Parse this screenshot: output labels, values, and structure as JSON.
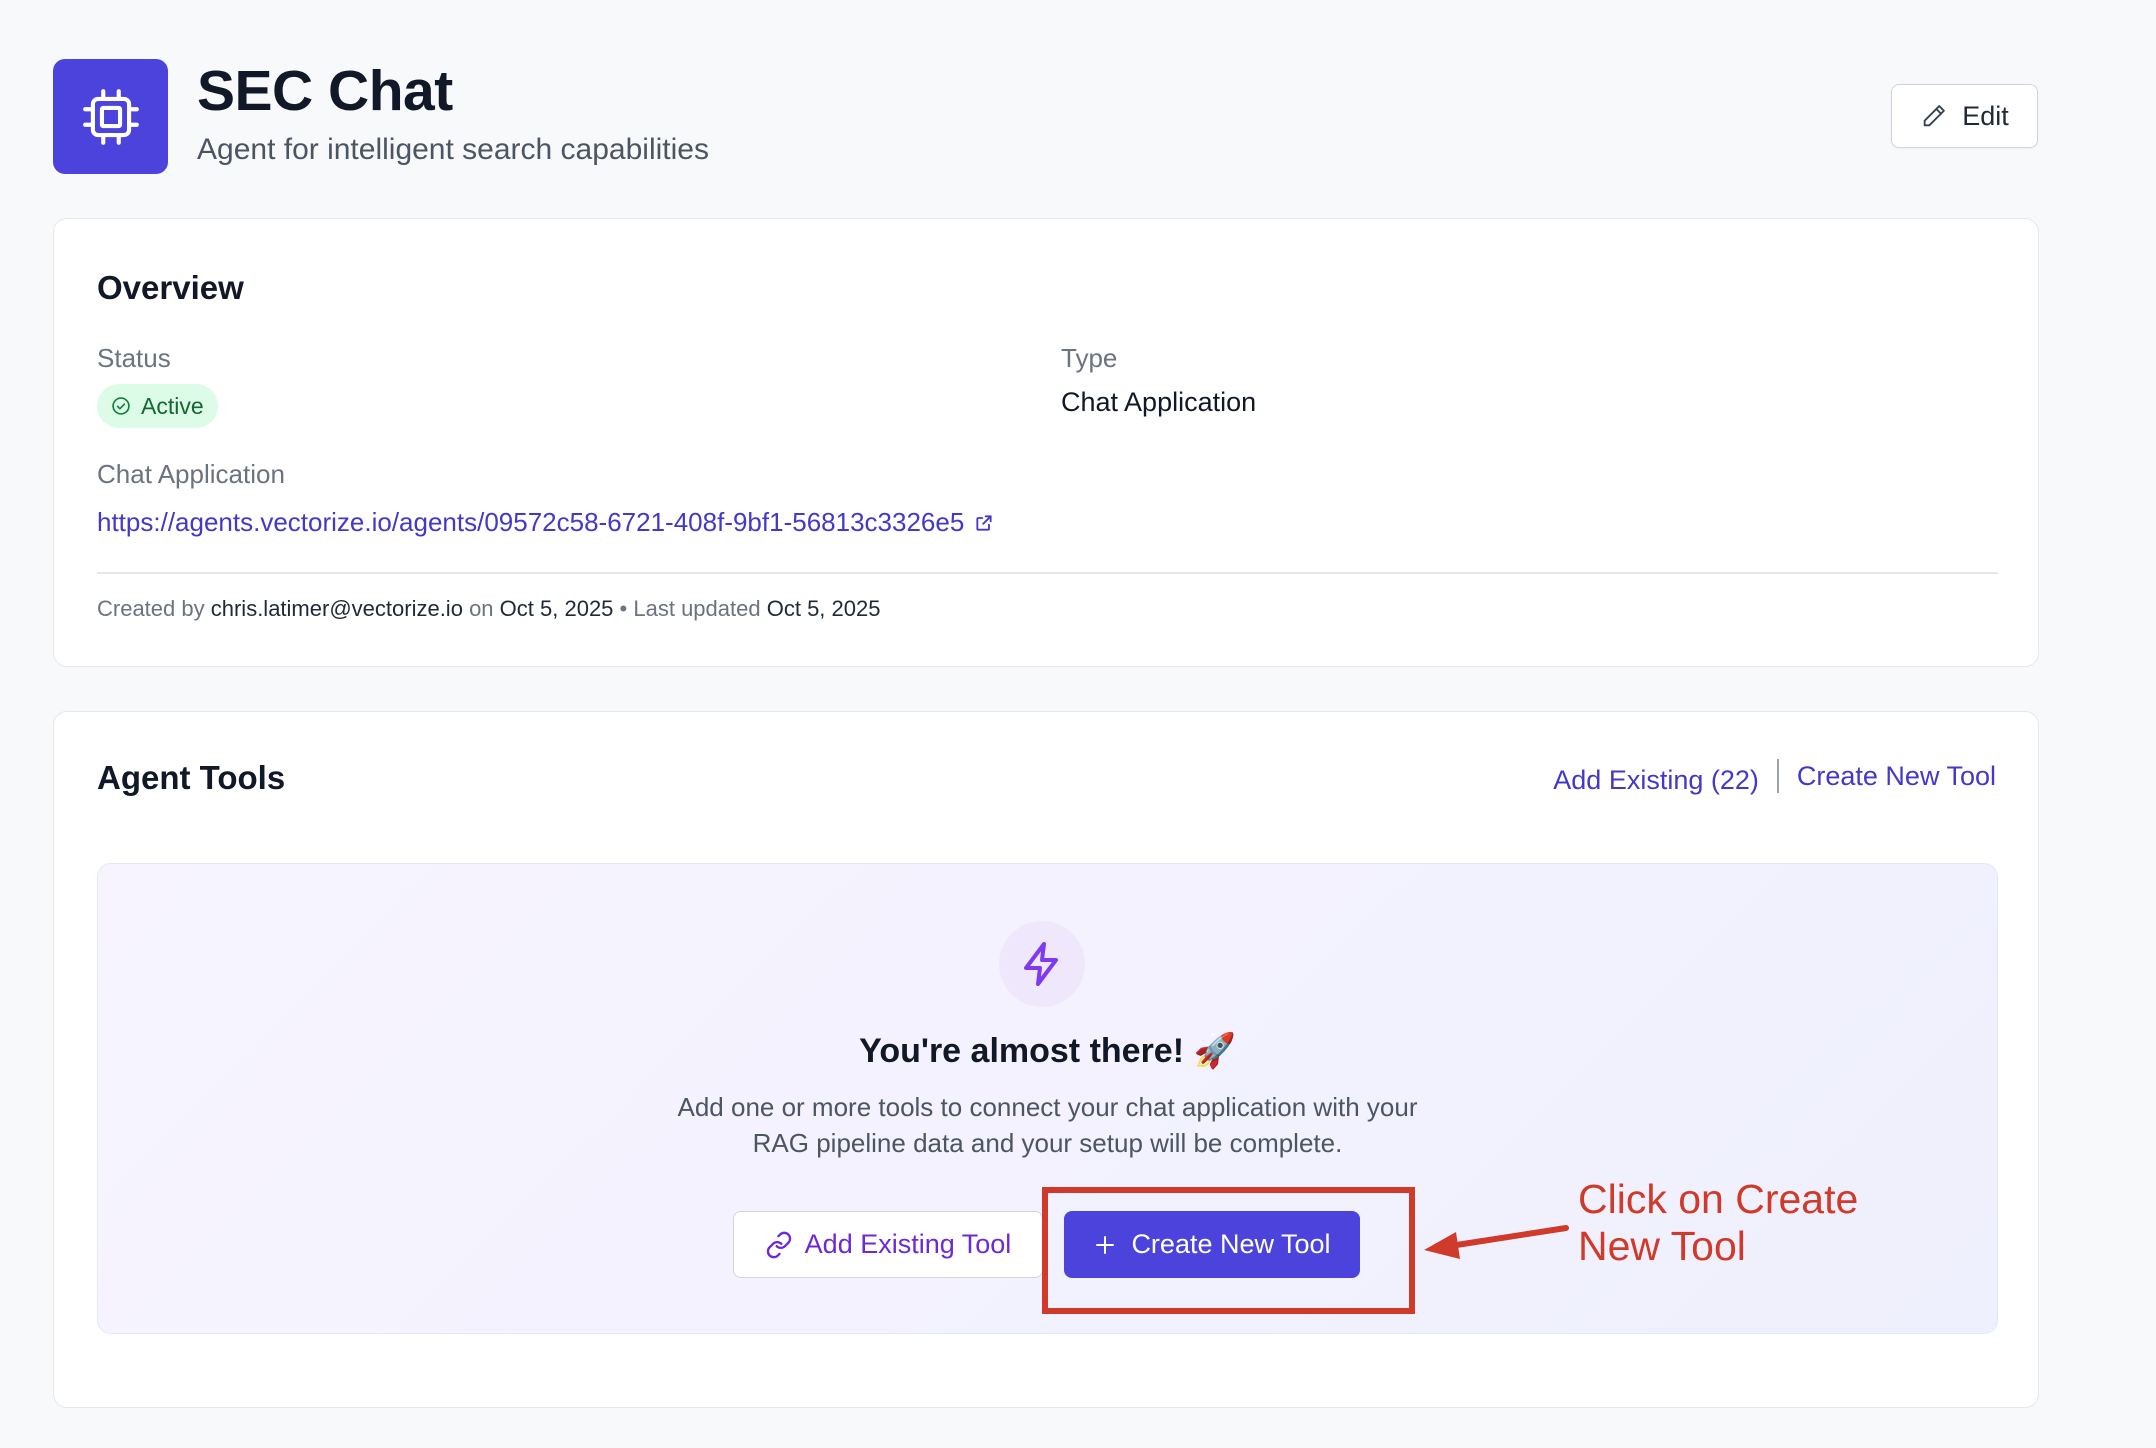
{
  "header": {
    "app_icon": "cpu-chip-icon",
    "title": "SEC Chat",
    "subtitle": "Agent for intelligent search capabilities",
    "edit_label": "Edit"
  },
  "overview": {
    "heading": "Overview",
    "status_label": "Status",
    "status_value": "Active",
    "type_label": "Type",
    "type_value": "Chat Application",
    "chat_app_label": "Chat Application",
    "chat_app_url": "https://agents.vectorize.io/agents/09572c58-6721-408f-9bf1-56813c3326e5",
    "meta": {
      "created_by_prefix": "Created by",
      "created_by": "chris.latimer@vectorize.io",
      "on_word": "on",
      "created_date": "Oct 5, 2025",
      "separator": "•",
      "last_updated_prefix": "Last updated",
      "updated_date": "Oct 5, 2025"
    }
  },
  "agent_tools": {
    "heading": "Agent Tools",
    "add_existing_link": "Add Existing (22)",
    "create_new_link": "Create New Tool",
    "empty_state": {
      "icon": "lightning-bolt-icon",
      "title": "You're almost there! 🚀",
      "description_line1": "Add one or more tools to connect your chat application with your",
      "description_line2": "RAG pipeline data and your setup will be complete.",
      "add_existing_button": "Add Existing Tool",
      "create_new_button": "Create New Tool"
    }
  },
  "annotation": {
    "text_line1": "Click on Create",
    "text_line2": "New Tool",
    "color": "#d03a2b"
  },
  "colors": {
    "brand": "#4b43dc",
    "link": "#4338ca",
    "status_active_bg": "#dcfce7",
    "status_active_text": "#166534"
  }
}
